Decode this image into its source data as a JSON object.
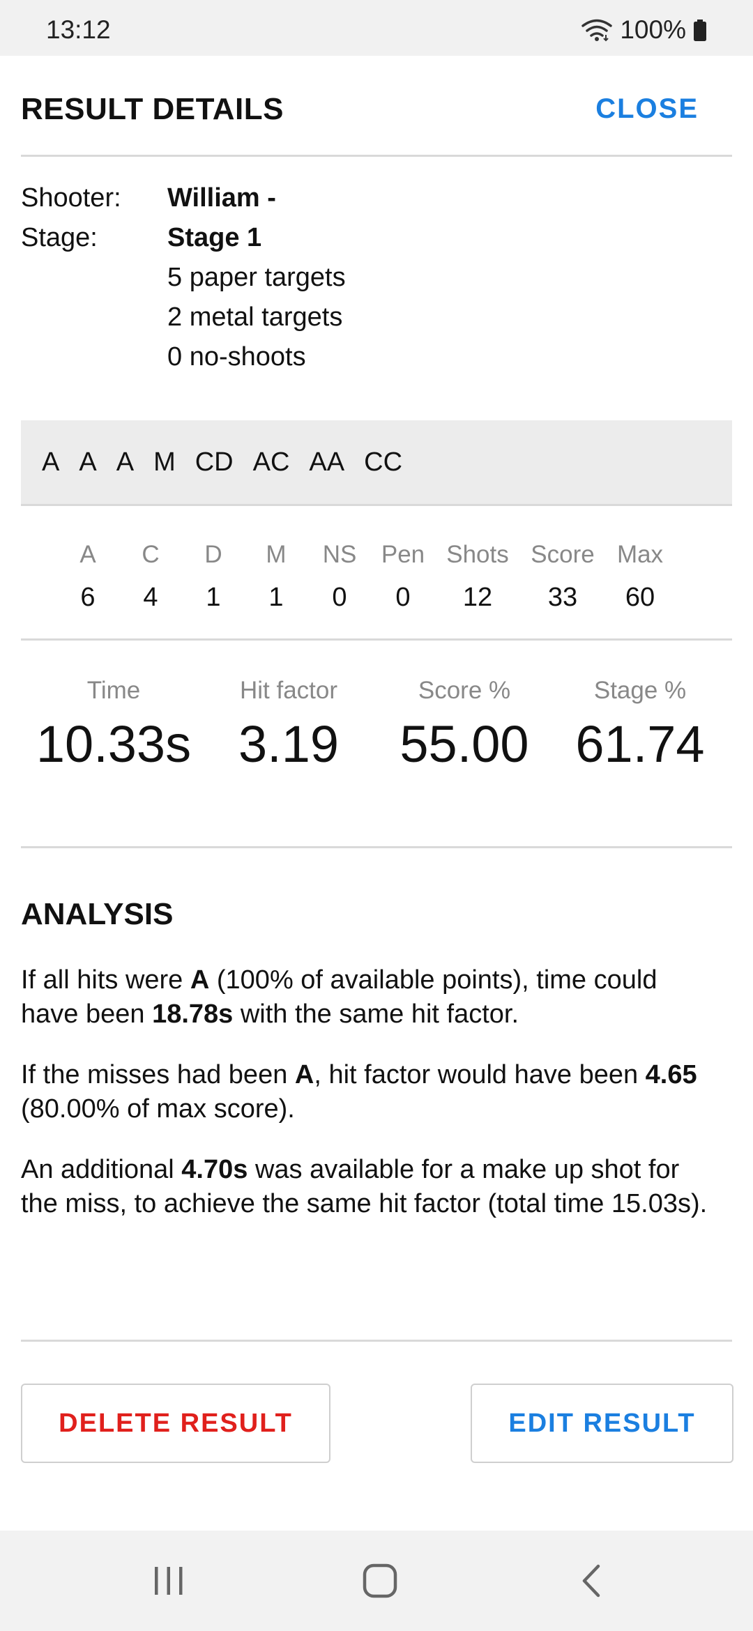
{
  "status_bar": {
    "time": "13:12",
    "battery": "100%"
  },
  "header": {
    "title": "RESULT DETAILS",
    "close_label": "CLOSE"
  },
  "info": {
    "shooter_label": "Shooter:",
    "shooter_value": "William -",
    "stage_label": "Stage:",
    "stage_value": "Stage 1",
    "details": [
      "5 paper targets",
      "2 metal targets",
      "0 no-shoots"
    ]
  },
  "hits": [
    "A",
    "A",
    "A",
    "M",
    "CD",
    "AC",
    "AA",
    "CC"
  ],
  "counts": {
    "headers": [
      "A",
      "C",
      "D",
      "M",
      "NS",
      "Pen",
      "Shots",
      "Score",
      "Max"
    ],
    "values": [
      "6",
      "4",
      "1",
      "1",
      "0",
      "0",
      "12",
      "33",
      "60"
    ]
  },
  "stats": [
    {
      "label": "Time",
      "value": "10.33s"
    },
    {
      "label": "Hit factor",
      "value": "3.19"
    },
    {
      "label": "Score %",
      "value": "55.00"
    },
    {
      "label": "Stage %",
      "value": "61.74"
    }
  ],
  "analysis": {
    "title": "ANALYSIS",
    "p1": {
      "t1": "If all hits were ",
      "b1": "A",
      "t2": " (100% of available points), time could have been ",
      "b2": "18.78s",
      "t3": " with the same hit factor."
    },
    "p2": {
      "t1": "If the misses had been ",
      "b1": "A",
      "t2": ", hit factor would have been ",
      "b2": "4.65",
      "t3": " (80.00% of max score)."
    },
    "p3": {
      "t1": "An additional ",
      "b1": "4.70s",
      "t2": " was available for a make up shot for the miss, to achieve the same hit factor (total time 15.03s)."
    }
  },
  "buttons": {
    "delete_label": "DELETE RESULT",
    "edit_label": "EDIT RESULT"
  },
  "nav": {
    "icons": [
      "recent-apps-icon",
      "home-icon",
      "back-icon"
    ]
  },
  "colors": {
    "accent": "#1b7fe0",
    "danger": "#e0201c"
  }
}
